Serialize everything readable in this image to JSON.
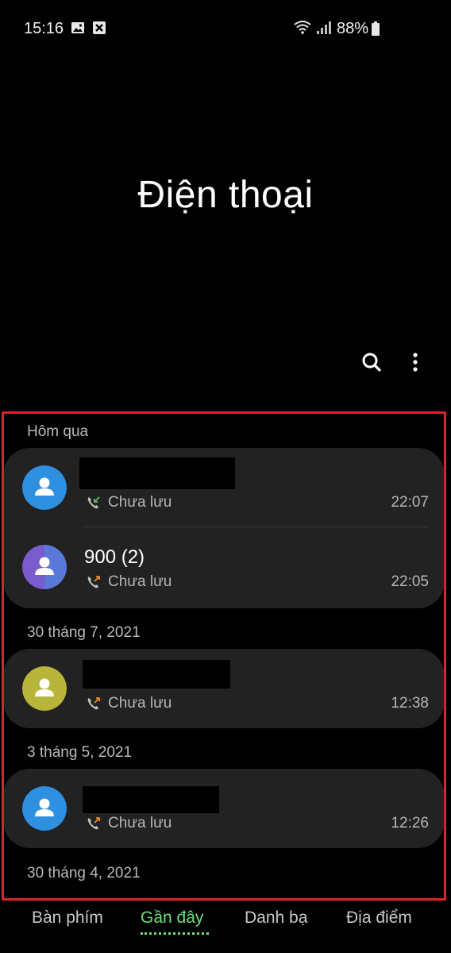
{
  "status_bar": {
    "time": "15:16",
    "battery": "88%",
    "icons": [
      "image-icon",
      "blocked-notification-icon",
      "wifi-icon",
      "signal-icon",
      "battery-icon"
    ]
  },
  "app_title": "Điện thoại",
  "toolbar": {
    "icons": [
      "search-icon",
      "more-vert-icon"
    ]
  },
  "colors": {
    "background": "#000000",
    "card": "#222222",
    "accent": "#6ee07a",
    "highlight_border": "#e0202a",
    "incoming_call": "#5ec25a",
    "outgoing_call": "#f08a24"
  },
  "call_log": {
    "groups": [
      {
        "date": "Hôm qua",
        "entries": [
          {
            "name": "",
            "status": "Chưa lưu",
            "time": "22:07",
            "call_type": "incoming",
            "avatar_color": "#2f8fe0"
          },
          {
            "name": "900 (2)",
            "status": "Chưa lưu",
            "time": "22:05",
            "call_type": "outgoing",
            "avatar_color": "#7b5ccf"
          }
        ]
      },
      {
        "date": "30 tháng 7, 2021",
        "entries": [
          {
            "name": "",
            "status": "Chưa lưu",
            "time": "12:38",
            "call_type": "outgoing",
            "avatar_color": "#b7b53a"
          }
        ]
      },
      {
        "date": "3 tháng 5, 2021",
        "entries": [
          {
            "name": "",
            "status": "Chưa lưu",
            "time": "12:26",
            "call_type": "outgoing",
            "avatar_color": "#2f8fe0"
          }
        ]
      },
      {
        "date": "30 tháng 4, 2021",
        "entries": []
      }
    ]
  },
  "bottom_nav": {
    "tabs": [
      "Bàn phím",
      "Gần đây",
      "Danh bạ",
      "Địa điểm"
    ],
    "active": "Gần đây"
  }
}
